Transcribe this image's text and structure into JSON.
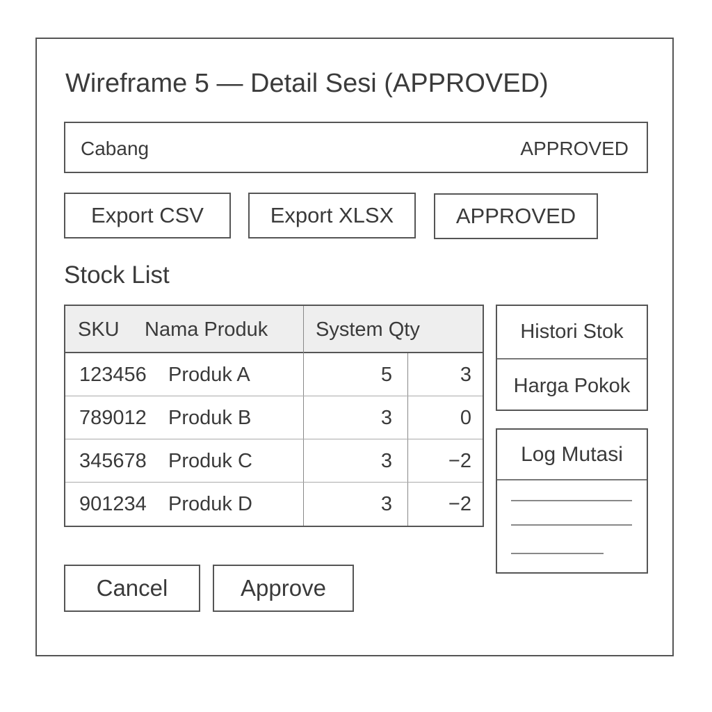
{
  "page": {
    "title": "Wireframe 5 — Detail Sesi (APPROVED)"
  },
  "header": {
    "branch_label": "Cabang",
    "status": "APPROVED"
  },
  "toolbar": {
    "export_csv_label": "Export CSV",
    "export_xlsx_label": "Export XLSX",
    "status_button_label": "APPROVED"
  },
  "stock_list": {
    "title": "Stock List",
    "columns": {
      "sku": "SKU",
      "name": "Nama Produk",
      "system_qty": "System Qty"
    },
    "rows": [
      {
        "sku": "123456",
        "name": "Produk A",
        "system_qty": "5",
        "diff": "3"
      },
      {
        "sku": "789012",
        "name": "Produk B",
        "system_qty": "3",
        "diff": "0"
      },
      {
        "sku": "345678",
        "name": "Produk C",
        "system_qty": "3",
        "diff": "−2"
      },
      {
        "sku": "901234",
        "name": "Produk D",
        "system_qty": "3",
        "diff": "−2"
      }
    ]
  },
  "side_menu": {
    "items": [
      {
        "label": "Histori Stok"
      },
      {
        "label": "Harga Pokok"
      }
    ]
  },
  "log_panel": {
    "title": "Log Mutasi"
  },
  "footer": {
    "cancel_label": "Cancel",
    "approve_label": "Approve"
  }
}
